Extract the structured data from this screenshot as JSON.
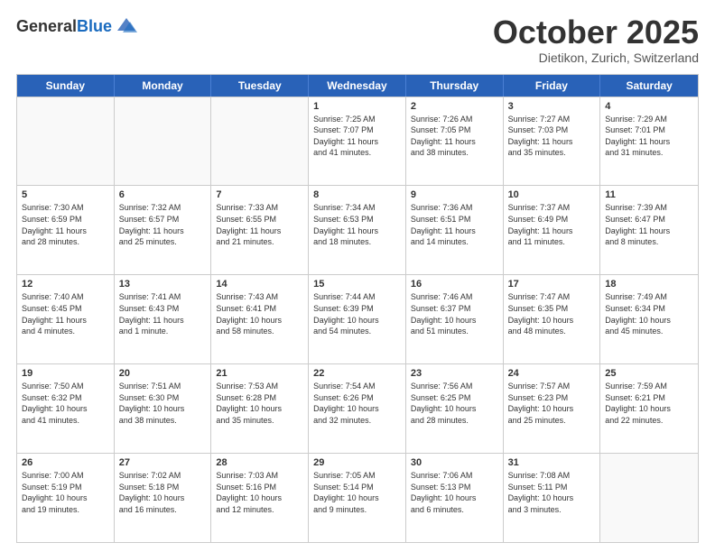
{
  "header": {
    "logo_line1": "General",
    "logo_line2": "Blue",
    "month": "October 2025",
    "location": "Dietikon, Zurich, Switzerland"
  },
  "weekdays": [
    "Sunday",
    "Monday",
    "Tuesday",
    "Wednesday",
    "Thursday",
    "Friday",
    "Saturday"
  ],
  "rows": [
    [
      {
        "day": "",
        "info": ""
      },
      {
        "day": "",
        "info": ""
      },
      {
        "day": "",
        "info": ""
      },
      {
        "day": "1",
        "info": "Sunrise: 7:25 AM\nSunset: 7:07 PM\nDaylight: 11 hours\nand 41 minutes."
      },
      {
        "day": "2",
        "info": "Sunrise: 7:26 AM\nSunset: 7:05 PM\nDaylight: 11 hours\nand 38 minutes."
      },
      {
        "day": "3",
        "info": "Sunrise: 7:27 AM\nSunset: 7:03 PM\nDaylight: 11 hours\nand 35 minutes."
      },
      {
        "day": "4",
        "info": "Sunrise: 7:29 AM\nSunset: 7:01 PM\nDaylight: 11 hours\nand 31 minutes."
      }
    ],
    [
      {
        "day": "5",
        "info": "Sunrise: 7:30 AM\nSunset: 6:59 PM\nDaylight: 11 hours\nand 28 minutes."
      },
      {
        "day": "6",
        "info": "Sunrise: 7:32 AM\nSunset: 6:57 PM\nDaylight: 11 hours\nand 25 minutes."
      },
      {
        "day": "7",
        "info": "Sunrise: 7:33 AM\nSunset: 6:55 PM\nDaylight: 11 hours\nand 21 minutes."
      },
      {
        "day": "8",
        "info": "Sunrise: 7:34 AM\nSunset: 6:53 PM\nDaylight: 11 hours\nand 18 minutes."
      },
      {
        "day": "9",
        "info": "Sunrise: 7:36 AM\nSunset: 6:51 PM\nDaylight: 11 hours\nand 14 minutes."
      },
      {
        "day": "10",
        "info": "Sunrise: 7:37 AM\nSunset: 6:49 PM\nDaylight: 11 hours\nand 11 minutes."
      },
      {
        "day": "11",
        "info": "Sunrise: 7:39 AM\nSunset: 6:47 PM\nDaylight: 11 hours\nand 8 minutes."
      }
    ],
    [
      {
        "day": "12",
        "info": "Sunrise: 7:40 AM\nSunset: 6:45 PM\nDaylight: 11 hours\nand 4 minutes."
      },
      {
        "day": "13",
        "info": "Sunrise: 7:41 AM\nSunset: 6:43 PM\nDaylight: 11 hours\nand 1 minute."
      },
      {
        "day": "14",
        "info": "Sunrise: 7:43 AM\nSunset: 6:41 PM\nDaylight: 10 hours\nand 58 minutes."
      },
      {
        "day": "15",
        "info": "Sunrise: 7:44 AM\nSunset: 6:39 PM\nDaylight: 10 hours\nand 54 minutes."
      },
      {
        "day": "16",
        "info": "Sunrise: 7:46 AM\nSunset: 6:37 PM\nDaylight: 10 hours\nand 51 minutes."
      },
      {
        "day": "17",
        "info": "Sunrise: 7:47 AM\nSunset: 6:35 PM\nDaylight: 10 hours\nand 48 minutes."
      },
      {
        "day": "18",
        "info": "Sunrise: 7:49 AM\nSunset: 6:34 PM\nDaylight: 10 hours\nand 45 minutes."
      }
    ],
    [
      {
        "day": "19",
        "info": "Sunrise: 7:50 AM\nSunset: 6:32 PM\nDaylight: 10 hours\nand 41 minutes."
      },
      {
        "day": "20",
        "info": "Sunrise: 7:51 AM\nSunset: 6:30 PM\nDaylight: 10 hours\nand 38 minutes."
      },
      {
        "day": "21",
        "info": "Sunrise: 7:53 AM\nSunset: 6:28 PM\nDaylight: 10 hours\nand 35 minutes."
      },
      {
        "day": "22",
        "info": "Sunrise: 7:54 AM\nSunset: 6:26 PM\nDaylight: 10 hours\nand 32 minutes."
      },
      {
        "day": "23",
        "info": "Sunrise: 7:56 AM\nSunset: 6:25 PM\nDaylight: 10 hours\nand 28 minutes."
      },
      {
        "day": "24",
        "info": "Sunrise: 7:57 AM\nSunset: 6:23 PM\nDaylight: 10 hours\nand 25 minutes."
      },
      {
        "day": "25",
        "info": "Sunrise: 7:59 AM\nSunset: 6:21 PM\nDaylight: 10 hours\nand 22 minutes."
      }
    ],
    [
      {
        "day": "26",
        "info": "Sunrise: 7:00 AM\nSunset: 5:19 PM\nDaylight: 10 hours\nand 19 minutes."
      },
      {
        "day": "27",
        "info": "Sunrise: 7:02 AM\nSunset: 5:18 PM\nDaylight: 10 hours\nand 16 minutes."
      },
      {
        "day": "28",
        "info": "Sunrise: 7:03 AM\nSunset: 5:16 PM\nDaylight: 10 hours\nand 12 minutes."
      },
      {
        "day": "29",
        "info": "Sunrise: 7:05 AM\nSunset: 5:14 PM\nDaylight: 10 hours\nand 9 minutes."
      },
      {
        "day": "30",
        "info": "Sunrise: 7:06 AM\nSunset: 5:13 PM\nDaylight: 10 hours\nand 6 minutes."
      },
      {
        "day": "31",
        "info": "Sunrise: 7:08 AM\nSunset: 5:11 PM\nDaylight: 10 hours\nand 3 minutes."
      },
      {
        "day": "",
        "info": ""
      }
    ]
  ]
}
